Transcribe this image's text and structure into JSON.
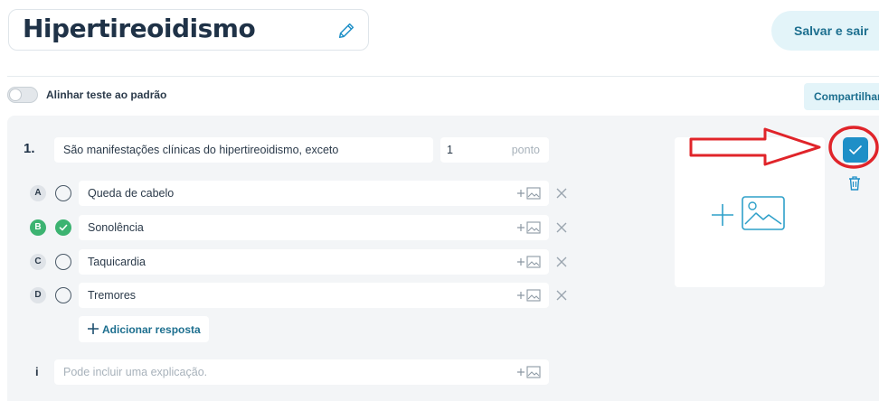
{
  "header": {
    "title": "Hipertireoidismo",
    "save_label": "Salvar e sair"
  },
  "toolbar": {
    "align_label": "Alinhar teste ao padrão",
    "share_label": "Compartilhar"
  },
  "question": {
    "number": "1.",
    "text": "São manifestações clínicas do hipertireoidismo, exceto",
    "points_value": "1",
    "points_unit": "ponto",
    "answers": [
      {
        "letter": "A",
        "text": "Queda de cabelo",
        "correct": false
      },
      {
        "letter": "B",
        "text": "Sonolência",
        "correct": true
      },
      {
        "letter": "C",
        "text": "Taquicardia",
        "correct": false
      },
      {
        "letter": "D",
        "text": "Tremores",
        "correct": false
      }
    ],
    "add_answer_label": "Adicionar resposta",
    "info_marker": "i",
    "explanation_placeholder": "Pode incluir uma explicação."
  },
  "colors": {
    "accent": "#1e8fc7",
    "correct": "#3cb371",
    "annotation": "#e0242a"
  }
}
